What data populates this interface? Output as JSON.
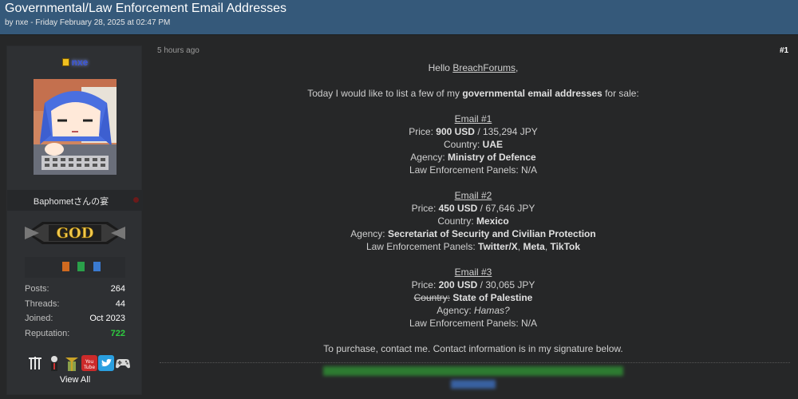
{
  "thread": {
    "title": "Governmental/Law Enforcement Email Addresses",
    "meta": "by nxe - Friday February 28, 2025 at 02:47 PM"
  },
  "user": {
    "name": "nxe",
    "usertitle": "Baphometさんの宴",
    "rank": "GOD",
    "stats": [
      {
        "label": "Posts:",
        "value": "264"
      },
      {
        "label": "Threads:",
        "value": "44"
      },
      {
        "label": "Joined:",
        "value": "Oct 2023"
      },
      {
        "label": "Reputation:",
        "value": "722"
      }
    ],
    "view_all": "View All",
    "colors": {
      "name": "#3b56d8",
      "reputation": "#2ecc40",
      "header": "#35597a"
    }
  },
  "post": {
    "time": "5 hours ago",
    "number": "#1",
    "greeting_prefix": "Hello ",
    "greeting_link": "BreachForums",
    "greeting_suffix": ",",
    "intro_a": "Today I would like to list a few of my ",
    "intro_b": "governmental email addresses",
    "intro_c": " for sale:",
    "emails": [
      {
        "heading": "Email #1",
        "price_label": "Price: ",
        "price_usd": "900 USD",
        "price_jpy": " / 135,294 JPY",
        "country_label": "Country: ",
        "country": "UAE",
        "agency_label": "Agency: ",
        "agency": "Ministry of Defence",
        "panels": "Law Enforcement Panels: N/A"
      },
      {
        "heading": "Email #2",
        "price_label": "Price: ",
        "price_usd": "450 USD",
        "price_jpy": " / 67,646 JPY",
        "country_label": "Country: ",
        "country": "Mexico",
        "agency_label": "Agency: ",
        "agency": "Secretariat of Security and Civilian Protection",
        "panels_label": "Law Enforcement Panels: ",
        "panels_a": "Twitter/X",
        "panels_sep1": ", ",
        "panels_b": "Meta",
        "panels_sep2": ", ",
        "panels_c": "TikTok"
      },
      {
        "heading": "Email #3",
        "price_label": "Price: ",
        "price_usd": "200 USD",
        "price_jpy": " / 30,065 JPY",
        "country_label": "Country:",
        "country": " State of Palestine",
        "agency_label": "Agency: ",
        "agency": "Hamas?",
        "panels": "Law Enforcement Panels: N/A"
      }
    ],
    "closing": "To purchase, contact me. Contact information is in my signature below."
  }
}
